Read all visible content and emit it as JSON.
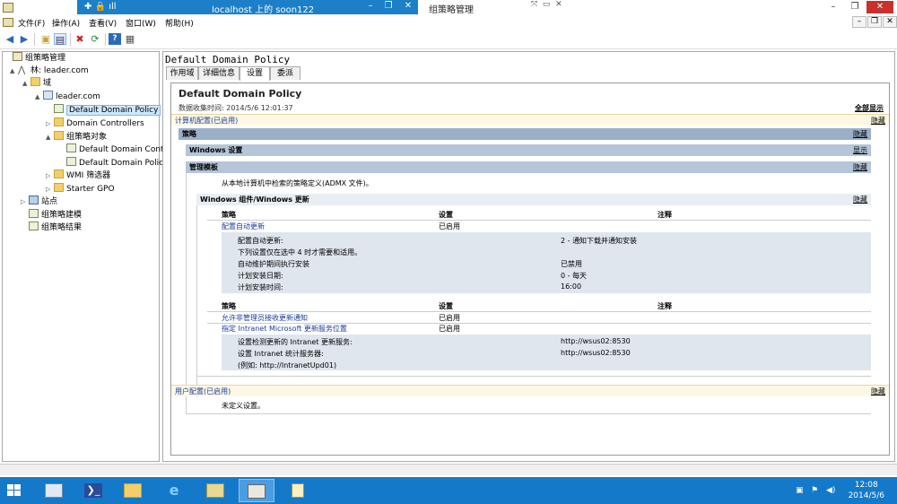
{
  "window": {
    "title": "组策略管理",
    "rdp_title": "localhost 上的 soon122"
  },
  "menu": [
    "文件(F)",
    "操作(A)",
    "查看(V)",
    "窗口(W)",
    "帮助(H)"
  ],
  "tree": [
    {
      "label": "组策略管理",
      "level": 0,
      "icon": "gpm-icon",
      "expand": ""
    },
    {
      "label": "林: leader.com",
      "level": 1,
      "icon": "forest-icon",
      "expand": "▲"
    },
    {
      "label": "域",
      "level": 2,
      "icon": "folder-icon",
      "expand": "▲"
    },
    {
      "label": "leader.com",
      "level": 3,
      "icon": "domain-icon",
      "expand": "▲"
    },
    {
      "label": "Default Domain Policy",
      "level": 4,
      "icon": "gpo-icon",
      "expand": "",
      "selected": true
    },
    {
      "label": "Domain Controllers",
      "level": 4,
      "icon": "folder-icon",
      "expand": "▷"
    },
    {
      "label": "组策略对象",
      "level": 4,
      "icon": "folder-icon",
      "expand": "▲"
    },
    {
      "label": "Default Domain Cont",
      "level": 5,
      "icon": "gpo-icon",
      "expand": ""
    },
    {
      "label": "Default Domain Polic",
      "level": 5,
      "icon": "gpo-icon",
      "expand": ""
    },
    {
      "label": "WMI 筛选器",
      "level": 4,
      "icon": "folder-icon",
      "expand": "▷"
    },
    {
      "label": "Starter GPO",
      "level": 4,
      "icon": "folder-icon",
      "expand": "▷"
    },
    {
      "label": "站点",
      "level": 1,
      "icon": "site-icon",
      "expand": "▷"
    },
    {
      "label": "组策略建模",
      "level": 1,
      "icon": "gpo-icon",
      "expand": ""
    },
    {
      "label": "组策略结果",
      "level": 1,
      "icon": "gpo-icon",
      "expand": ""
    }
  ],
  "right": {
    "title": "Default Domain Policy",
    "tabs": [
      "作用域",
      "详细信息",
      "设置",
      "委派"
    ],
    "active_tab": 2
  },
  "report": {
    "title": "Default Domain Policy",
    "collected": "数据收集时间: 2014/5/6 12:01:37",
    "show_all": "全部显示",
    "hide": "隐藏",
    "show": "显示",
    "computer_config": "计算机配置(已启用)",
    "policies": "策略",
    "windows_settings": "Windows 设置",
    "admin_templates": "管理模板",
    "admx_note": "从本地计算机中检索的策略定义(ADMX 文件)。",
    "wu_section": "Windows 组件/Windows 更新",
    "col_policy": "策略",
    "col_setting": "设置",
    "col_comment": "注释",
    "table1": {
      "policy": "配置自动更新",
      "setting": "已启用",
      "details": [
        {
          "label": "配置自动更新:",
          "value": "2 - 通知下载并通知安装"
        },
        {
          "label": "下列设置仅在选中 4 时才需要和适用。",
          "value": ""
        },
        {
          "label": "自动维护期间执行安装",
          "value": "已禁用"
        },
        {
          "label": "计划安装日期:",
          "value": "0 - 每天"
        },
        {
          "label": "计划安装时间:",
          "value": "16:00"
        }
      ]
    },
    "table2": {
      "rows": [
        {
          "policy": "允许非管理员接收更新通知",
          "setting": "已启用"
        },
        {
          "policy": "指定 Intranet Microsoft 更新服务位置",
          "setting": "已启用"
        }
      ],
      "details": [
        {
          "label": "设置检测更新的 Intranet 更新服务:",
          "value": "http://wsus02:8530"
        },
        {
          "label": "设置 Intranet 统计服务器:",
          "value": "http://wsus02:8530"
        },
        {
          "label": "(例如: http://IntranetUpd01)",
          "value": ""
        }
      ]
    },
    "user_config": "用户配置(已启用)",
    "no_settings": "未定义设置。"
  },
  "taskbar": {
    "time": "12:08",
    "date": "2014/5/6"
  }
}
